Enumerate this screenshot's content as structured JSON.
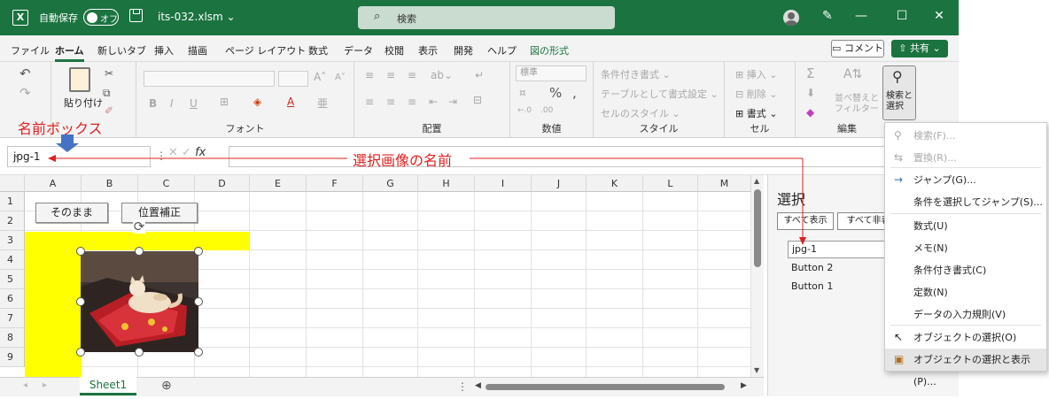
{
  "titlebar": {
    "logo": "X",
    "autosave": "自動保存",
    "toggle": "オフ",
    "filename": "its-032.xlsm ⌄",
    "search": "検索",
    "minimize": "—",
    "maximize": "☐",
    "close": "✕"
  },
  "tabs": [
    "ファイル",
    "ホーム",
    "新しいタブ",
    "挿入",
    "描画",
    "ページ レイアウト",
    "数式",
    "データ",
    "校閲",
    "表示",
    "開発",
    "ヘルプ",
    "図の形式"
  ],
  "buttons": {
    "comment": "コメント",
    "share": "共有"
  },
  "ribbon": {
    "paste": "貼り付け",
    "font_label": "フォント",
    "align_label": "配置",
    "number_label": "数値",
    "number_format": "標準",
    "style_label": "スタイル",
    "cond_format": "条件付き書式 ⌄",
    "table_format": "テーブルとして書式設定 ⌄",
    "cell_style": "セルのスタイル ⌄",
    "cell_label": "セル",
    "insert": "挿入",
    "delete": "削除",
    "format": "書式",
    "edit_label": "編集",
    "sort": "並べ替えと\nフィルター",
    "findsel": "検索と\n選択"
  },
  "annotations": {
    "namebox": "名前ボックス",
    "selected_name": "選択画像の名前"
  },
  "namebox": {
    "value": "jpg-1"
  },
  "columns": [
    "A",
    "B",
    "C",
    "D",
    "E",
    "F",
    "G",
    "H",
    "I",
    "J",
    "K",
    "L",
    "M"
  ],
  "rows": [
    "1",
    "2",
    "3",
    "4",
    "5",
    "6",
    "7",
    "8",
    "9"
  ],
  "sheet_buttons": {
    "b1": "そのまま",
    "b2": "位置補正"
  },
  "sheet_tab": "Sheet1",
  "selpane": {
    "title": "選択",
    "show_all": "すべて表示",
    "hide_all": "すべて非表",
    "items": [
      "jpg-1",
      "Button 2",
      "Button 1"
    ]
  },
  "menu": [
    {
      "label": "検索(F)...",
      "disabled": true,
      "icon": "search-icon"
    },
    {
      "label": "置換(R)...",
      "disabled": true,
      "icon": "replace-icon"
    },
    {
      "label": "ジャンプ(G)...",
      "disabled": false,
      "icon": "arrow-right-icon"
    },
    {
      "label": "条件を選択してジャンプ(S)...",
      "disabled": false
    },
    {
      "label": "数式(U)",
      "disabled": false
    },
    {
      "label": "メモ(N)",
      "disabled": false
    },
    {
      "label": "条件付き書式(C)",
      "disabled": false
    },
    {
      "label": "定数(N)",
      "disabled": false
    },
    {
      "label": "データの入力規則(V)",
      "disabled": false
    },
    {
      "label": "オブジェクトの選択(O)",
      "disabled": false,
      "icon": "pointer-icon"
    },
    {
      "label": "オブジェクトの選択と表示(P)...",
      "disabled": false,
      "icon": "selection-pane-icon",
      "highlight": true
    }
  ],
  "colors": {
    "excel_green": "#1b7340",
    "highlight_yellow": "#ffff00",
    "annotation_red": "#e02020"
  }
}
